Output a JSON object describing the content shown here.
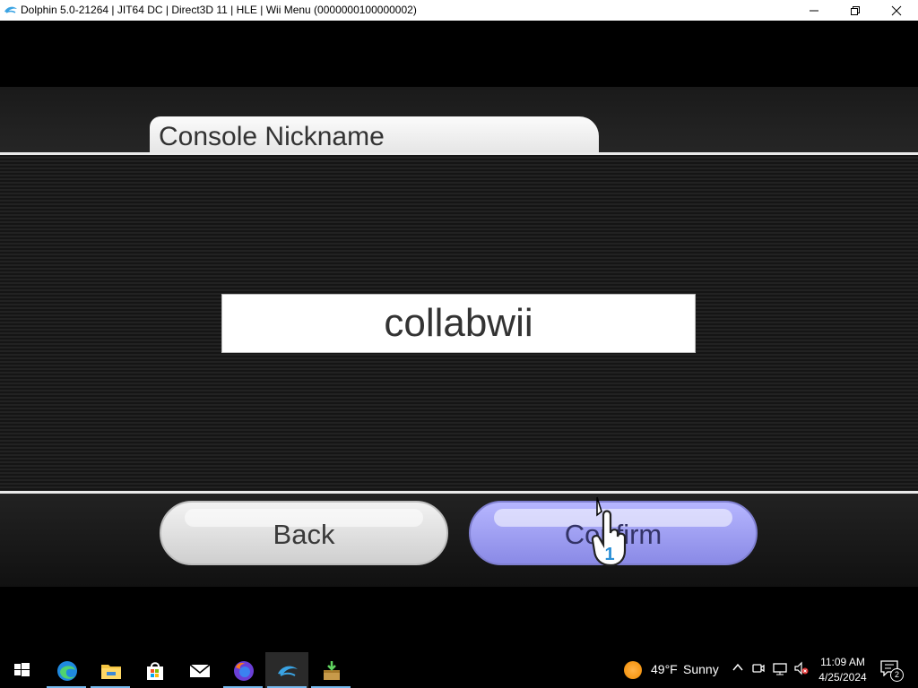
{
  "window": {
    "title": "Dolphin 5.0-21264 | JIT64 DC | Direct3D 11 | HLE | Wii Menu (0000000100000002)"
  },
  "screen": {
    "header": "Console Nickname",
    "nickname_value": "collabwii",
    "back_label": "Back",
    "confirm_label": "Confirm",
    "cursor_player": "1"
  },
  "taskbar": {
    "apps": [
      {
        "name": "start-icon"
      },
      {
        "name": "edge-icon"
      },
      {
        "name": "file-explorer-icon"
      },
      {
        "name": "microsoft-store-icon"
      },
      {
        "name": "mail-icon"
      },
      {
        "name": "firefox-icon"
      },
      {
        "name": "dolphin-icon",
        "active": true
      },
      {
        "name": "installer-icon"
      }
    ],
    "weather": {
      "temp": "49°F",
      "condition": "Sunny"
    },
    "clock": {
      "time": "11:09 AM",
      "date": "4/25/2024"
    },
    "notifications_count": "2"
  },
  "colors": {
    "confirm_accent": "#9d9df0",
    "taskbar_active_underline": "#76b9ed"
  }
}
